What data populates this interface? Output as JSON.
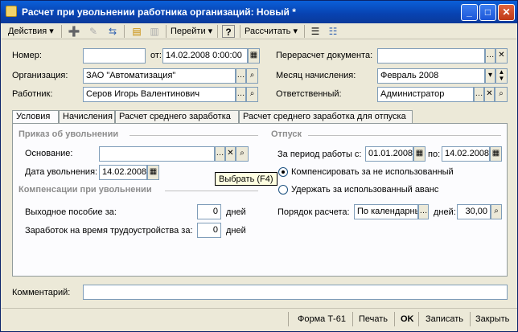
{
  "window": {
    "title": "Расчет при увольнении работника организаций: Новый *",
    "min_symbol": "_",
    "max_symbol": "□",
    "close_symbol": "✕"
  },
  "toolbar": {
    "actions": "Действия ▾",
    "goto": "Перейти ▾",
    "help": "?",
    "calculate": "Рассчитать ▾"
  },
  "header": {
    "number_label": "Номер:",
    "number_value": "",
    "date_label": "от:",
    "date_value": "14.02.2008  0:00:00",
    "org_label": "Организация:",
    "org_value": "ЗАО \"Автоматизация\"",
    "employee_label": "Работник:",
    "employee_value": "Серов Игорь Валентинович",
    "recalc_label": "Перерасчет документа:",
    "recalc_value": "",
    "month_label": "Месяц начисления:",
    "month_value": "Февраль 2008",
    "responsible_label": "Ответственный:",
    "responsible_value": "Администратор"
  },
  "tabs": [
    "Условия",
    "Начисления",
    "Расчет среднего заработка",
    "Расчет среднего заработка для отпуска"
  ],
  "conditions": {
    "order_section": "Приказ об увольнении",
    "basis_label": "Основание:",
    "basis_value": "",
    "dismissal_date_label": "Дата увольнения:",
    "dismissal_date_value": "14.02.2008",
    "comp_section": "Компенсации при увольнении",
    "severance_label": "Выходное пособие за:",
    "severance_value": "0",
    "severance_unit": "дней",
    "jobsearch_label": "Заработок на время трудоустройства за:",
    "jobsearch_value": "0",
    "jobsearch_unit": "дней",
    "vacation_section": "Отпуск",
    "period_label": "За период работы с:",
    "period_from": "01.01.2008",
    "period_to_label": "по:",
    "period_to": "14.02.2008",
    "radio_compensate": "Компенсировать за не использованный",
    "radio_withhold": "Удержать за использованный аванс",
    "calc_order_label": "Порядок расчета:",
    "calc_order_value": "По календарны",
    "days_label": "дней:",
    "days_value": "30,00",
    "tooltip": "Выбрать (F4)"
  },
  "comment": {
    "label": "Комментарий:",
    "value": ""
  },
  "footer": {
    "form": "Форма Т-61",
    "print": "Печать",
    "ok": "OK",
    "save": "Записать",
    "close": "Закрыть"
  }
}
